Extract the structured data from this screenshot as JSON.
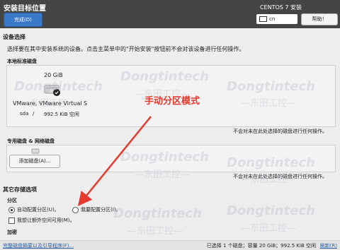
{
  "header": {
    "title": "安装目标位置",
    "done_label": "完成(D)",
    "product": "CENTOS 7 安装",
    "keyboard": "cn",
    "help_label": "帮助！"
  },
  "device_selection": {
    "heading": "设备选择",
    "description": "选择要在其中安装系统的设备。点击主菜单中的\"开始安装\"按钮前不会对该设备进行任何操作。",
    "local_heading": "本地标准磁盘",
    "disk": {
      "size": "20 GiB",
      "name": "VMware, VMware Virtual S",
      "device": "sda",
      "separator": "/",
      "free": "992.5 KiB 空闲"
    },
    "local_note": "不会对未在此处选择的磁盘进行任何操作。",
    "special_heading": "专用磁盘 & 网络磁盘",
    "add_disk_label": "添加磁盘(A)...",
    "special_note": "不会对未在此处选择的磁盘进行任何操作。"
  },
  "other_storage": {
    "heading": "其它存储选项",
    "partition_heading": "分区",
    "auto_label": "自动配置分区(U)。",
    "manual_label": "我要配置分区(I)。",
    "extra_space_label": "我想让额外空间可用(M)。",
    "encryption_heading": "加密"
  },
  "footer": {
    "summary_link": "完整磁盘摘要以及引导程序(F)...",
    "status": "已选择 1 个磁盘；容量 20 GiB；992.5 KiB 空闲",
    "refresh_link": "刷新(R)"
  },
  "annotation": {
    "text": "手动分区模式"
  },
  "watermark": {
    "brand": "Dongtintech",
    "chinese": "—东田工控—"
  },
  "colors": {
    "header_bg": "#454545",
    "accent": "#3a78c9",
    "annotation": "#e53a2d"
  }
}
